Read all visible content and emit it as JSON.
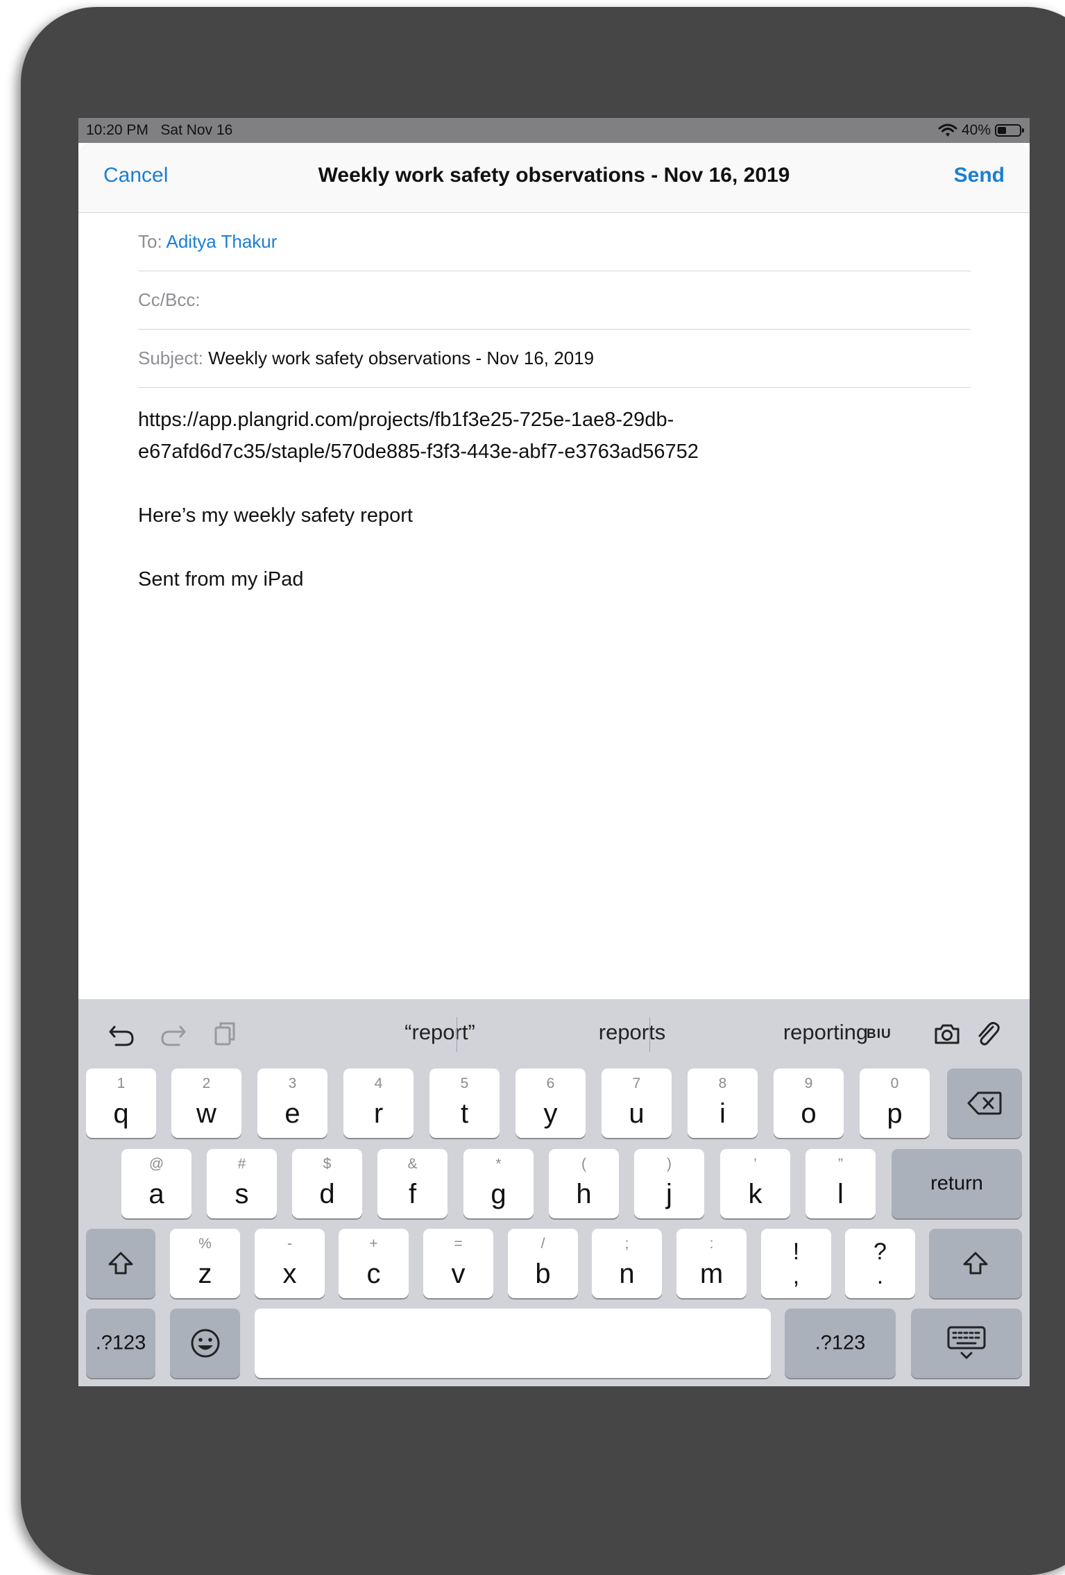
{
  "status": {
    "time": "10:20 PM",
    "date": "Sat Nov 16",
    "battery": "40%",
    "battery_level": 0.4
  },
  "nav": {
    "cancel": "Cancel",
    "title": "Weekly work safety observations - Nov 16, 2019",
    "send": "Send"
  },
  "fields": {
    "to_label": "To:",
    "to_value": "Aditya Thakur",
    "ccbcc_label": "Cc/Bcc:",
    "subject_label": "Subject:",
    "subject_value": "Weekly work safety observations - Nov 16, 2019"
  },
  "body": {
    "link_line1": "https://app.plangrid.com/projects/fb1f3e25-725e-1ae8-29db-",
    "link_line2": "e67afd6d7c35/staple/570de885-f3f3-443e-abf7-e3763ad56752",
    "message": "Here’s my weekly safety report",
    "signature": "Sent from my iPad"
  },
  "keyboard": {
    "suggestions": [
      "“report”",
      "reports",
      "reporting"
    ],
    "format_label": "BIU",
    "row1": [
      {
        "main": "q",
        "sub": "1"
      },
      {
        "main": "w",
        "sub": "2"
      },
      {
        "main": "e",
        "sub": "3"
      },
      {
        "main": "r",
        "sub": "4"
      },
      {
        "main": "t",
        "sub": "5"
      },
      {
        "main": "y",
        "sub": "6"
      },
      {
        "main": "u",
        "sub": "7"
      },
      {
        "main": "i",
        "sub": "8"
      },
      {
        "main": "o",
        "sub": "9"
      },
      {
        "main": "p",
        "sub": "0"
      }
    ],
    "row2": [
      {
        "main": "a",
        "sub": "@"
      },
      {
        "main": "s",
        "sub": "#"
      },
      {
        "main": "d",
        "sub": "$"
      },
      {
        "main": "f",
        "sub": "&"
      },
      {
        "main": "g",
        "sub": "*"
      },
      {
        "main": "h",
        "sub": "("
      },
      {
        "main": "j",
        "sub": ")"
      },
      {
        "main": "k",
        "sub": "’"
      },
      {
        "main": "l",
        "sub": "”"
      }
    ],
    "row3": [
      {
        "main": "z",
        "sub": "%"
      },
      {
        "main": "x",
        "sub": "-"
      },
      {
        "main": "c",
        "sub": "+"
      },
      {
        "main": "v",
        "sub": "="
      },
      {
        "main": "b",
        "sub": "/"
      },
      {
        "main": "n",
        "sub": ";"
      },
      {
        "main": "m",
        "sub": ":"
      },
      {
        "main": ",",
        "sub": "!"
      },
      {
        "main": ".",
        "sub": "?"
      }
    ],
    "return_label": "return",
    "numbers_label": ".?123"
  }
}
